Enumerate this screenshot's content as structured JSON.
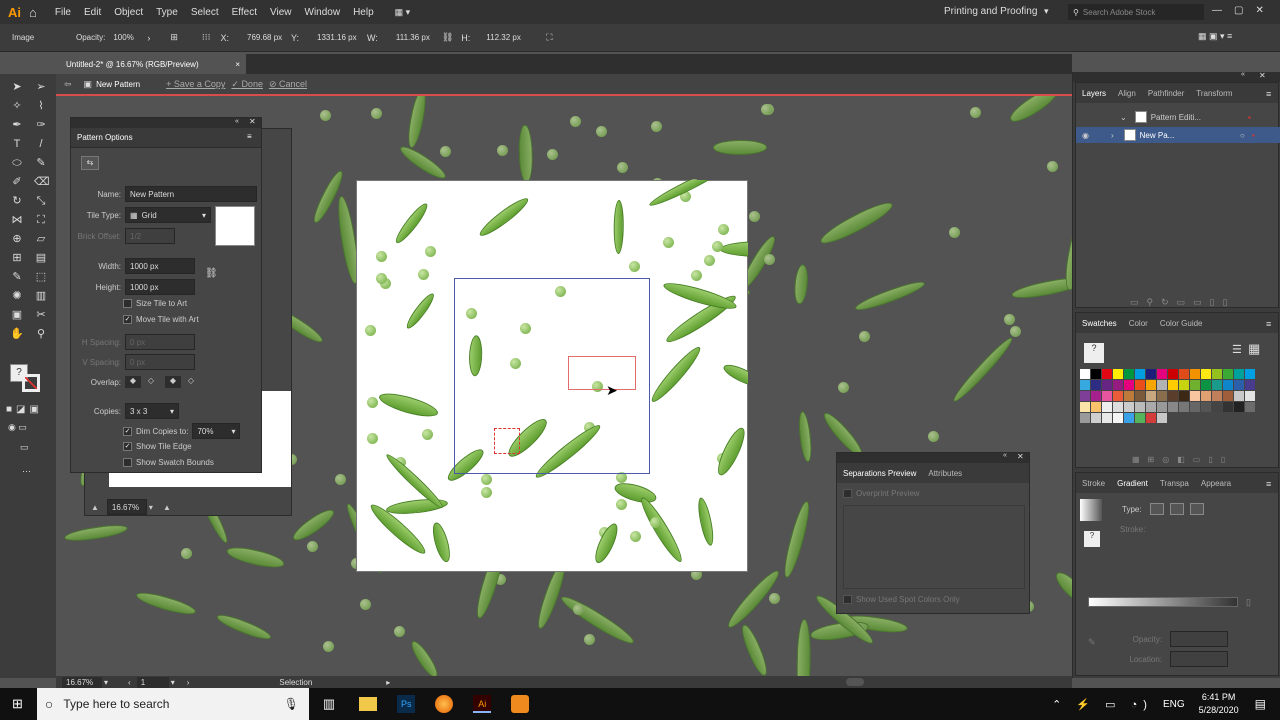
{
  "app": {
    "logo": "Ai",
    "workspace": "Printing and Proofing",
    "search_placeholder": "Search Adobe Stock"
  },
  "menu": [
    "File",
    "Edit",
    "Object",
    "Type",
    "Select",
    "Effect",
    "View",
    "Window",
    "Help"
  ],
  "control": {
    "selection_type": "Image",
    "opacity_label": "Opacity:",
    "opacity": "100%",
    "x_label": "X:",
    "x": "769.68 px",
    "y_label": "Y:",
    "y": "1331.16 px",
    "w_label": "W:",
    "w": "111.36 px",
    "h_label": "H:",
    "h": "112.32 px"
  },
  "doc_tab": {
    "title": "Untitled-2* @ 16.67% (RGB/Preview)",
    "close": "×"
  },
  "pattern_bar": {
    "mode": "New Pattern",
    "save_copy": "Save a Copy",
    "done": "Done",
    "cancel": "Cancel"
  },
  "pattern_options": {
    "title": "Pattern Options",
    "name_label": "Name:",
    "name": "New Pattern",
    "tile_type_label": "Tile Type:",
    "tile_type": "Grid",
    "brick_offset_label": "Brick Offset:",
    "brick_offset": "1/2",
    "width_label": "Width:",
    "width": "1000 px",
    "height_label": "Height:",
    "height": "1000 px",
    "size_tile": "Size Tile to Art",
    "move_tile": "Move Tile with Art",
    "h_spacing_label": "H Spacing:",
    "h_spacing": "0 px",
    "v_spacing_label": "V Spacing:",
    "v_spacing": "0 px",
    "overlap_label": "Overlap:",
    "copies_label": "Copies:",
    "copies": "3 x 3",
    "dim_label": "Dim Copies to:",
    "dim_value": "70%",
    "show_edge": "Show Tile Edge",
    "show_bounds": "Show Swatch Bounds"
  },
  "navigator": {
    "zoom": "16.67%"
  },
  "layers_panel": {
    "tabs": [
      "Layers",
      "Align",
      "Pathfinder",
      "Transform"
    ],
    "layer1": "Pattern Editi...",
    "layer2": "New Pa..."
  },
  "swatches_panel": {
    "tabs": [
      "Swatches",
      "Color",
      "Color Guide"
    ]
  },
  "gradient_panel": {
    "tabs": [
      "Stroke",
      "Gradient",
      "Transpa",
      "Appeara"
    ],
    "type_label": "Type:",
    "stroke_label": "Stroke:",
    "opacity_label": "Opacity:",
    "location_label": "Location:"
  },
  "separations_panel": {
    "tabs": [
      "Separations Preview",
      "Attributes"
    ],
    "overprint": "Overprint Preview",
    "spot": "Show Used Spot Colors Only"
  },
  "status": {
    "zoom": "16.67%",
    "page": "1",
    "tool": "Selection"
  },
  "taskbar": {
    "search": "Type here to search",
    "lang": "ENG",
    "time": "6:41 PM",
    "date": "5/28/2020"
  },
  "colors": {
    "accent": "#d94c4c",
    "panel": "#464646",
    "canvas": "#535353"
  }
}
